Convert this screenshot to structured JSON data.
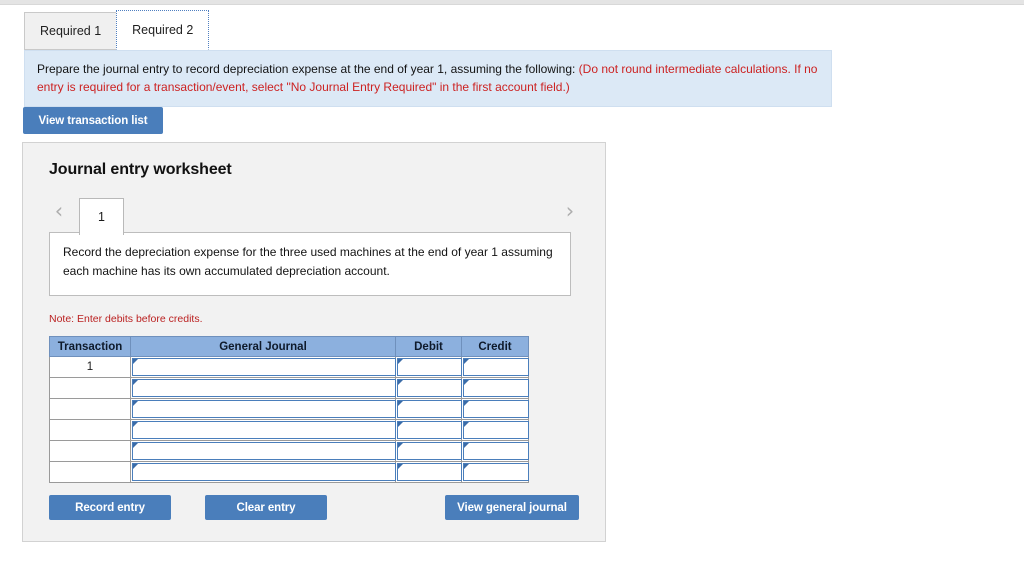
{
  "tabs": [
    {
      "label": "Required 1",
      "active": false
    },
    {
      "label": "Required 2",
      "active": true
    }
  ],
  "instruction": {
    "black_text": "Prepare the journal entry to record depreciation expense at the end of year 1, assuming the following: ",
    "red_text": "(Do not round intermediate calculations. If no entry is required for a transaction/event, select \"No Journal Entry Required\" in the first account field.)"
  },
  "toolbar": {
    "view_transaction_list_label": "View transaction list"
  },
  "worksheet": {
    "title": "Journal entry worksheet",
    "pager": {
      "prev_icon": "chevron-left-icon",
      "next_icon": "chevron-right-icon",
      "pages": [
        "1"
      ],
      "current_page": "1"
    },
    "description": "Record the depreciation expense for the three used machines at the end of year 1 assuming each machine has its own accumulated depreciation account.",
    "note": "Note: Enter debits before credits.",
    "table": {
      "columns": [
        "Transaction",
        "General Journal",
        "Debit",
        "Credit"
      ],
      "rows": [
        {
          "transaction": "1",
          "general_journal": "",
          "debit": "",
          "credit": ""
        },
        {
          "transaction": "",
          "general_journal": "",
          "debit": "",
          "credit": ""
        },
        {
          "transaction": "",
          "general_journal": "",
          "debit": "",
          "credit": ""
        },
        {
          "transaction": "",
          "general_journal": "",
          "debit": "",
          "credit": ""
        },
        {
          "transaction": "",
          "general_journal": "",
          "debit": "",
          "credit": ""
        },
        {
          "transaction": "",
          "general_journal": "",
          "debit": "",
          "credit": ""
        }
      ]
    },
    "actions": {
      "record_entry_label": "Record entry",
      "clear_entry_label": "Clear entry",
      "view_general_journal_label": "View general journal"
    }
  },
  "colors": {
    "button_blue": "#4a7ebb",
    "table_header_blue": "#8cb0de",
    "banner_blue": "#dce9f6",
    "note_red": "#bb2222",
    "panel_gray": "#f2f2f2"
  }
}
